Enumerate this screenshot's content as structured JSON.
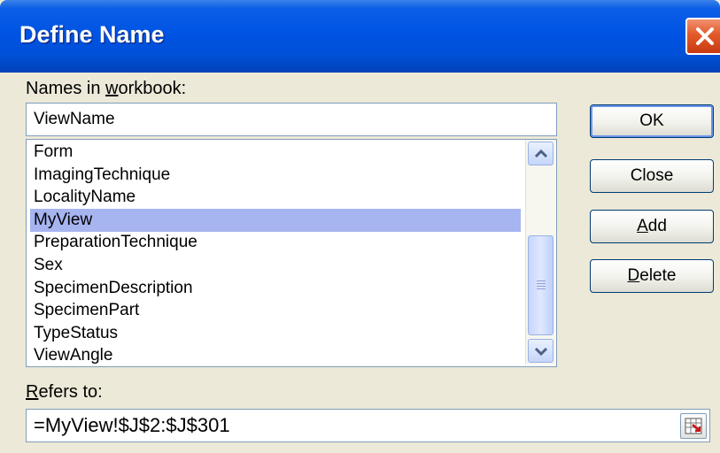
{
  "window": {
    "title": "Define Name"
  },
  "names_label": {
    "before": "Names in ",
    "accel": "w",
    "after": "orkbook:"
  },
  "name_input": {
    "value": "ViewName"
  },
  "names_list": {
    "items": [
      {
        "label": "Form",
        "selected": false
      },
      {
        "label": "ImagingTechnique",
        "selected": false
      },
      {
        "label": "LocalityName",
        "selected": false
      },
      {
        "label": "MyView",
        "selected": true
      },
      {
        "label": "PreparationTechnique",
        "selected": false
      },
      {
        "label": "Sex",
        "selected": false
      },
      {
        "label": "SpecimenDescription",
        "selected": false
      },
      {
        "label": "SpecimenPart",
        "selected": false
      },
      {
        "label": "TypeStatus",
        "selected": false
      },
      {
        "label": "ViewAngle",
        "selected": false
      }
    ]
  },
  "buttons": {
    "ok": "OK",
    "close": "Close",
    "add": {
      "accel": "A",
      "rest": "dd"
    },
    "delete": {
      "accel": "D",
      "rest": "elete"
    }
  },
  "refers_label": {
    "accel": "R",
    "rest": "efers to:"
  },
  "refers_input": {
    "value": "=MyView!$J$2:$J$301"
  },
  "icons": {
    "close": "close-x-icon",
    "scroll_up": "chevron-up-icon",
    "scroll_down": "chevron-down-icon",
    "range_picker": "collapse-dialog-icon"
  },
  "colors": {
    "titlebar": "#0054e3",
    "selection": "#a6b4f0",
    "dialog_bg": "#ece9d8"
  }
}
